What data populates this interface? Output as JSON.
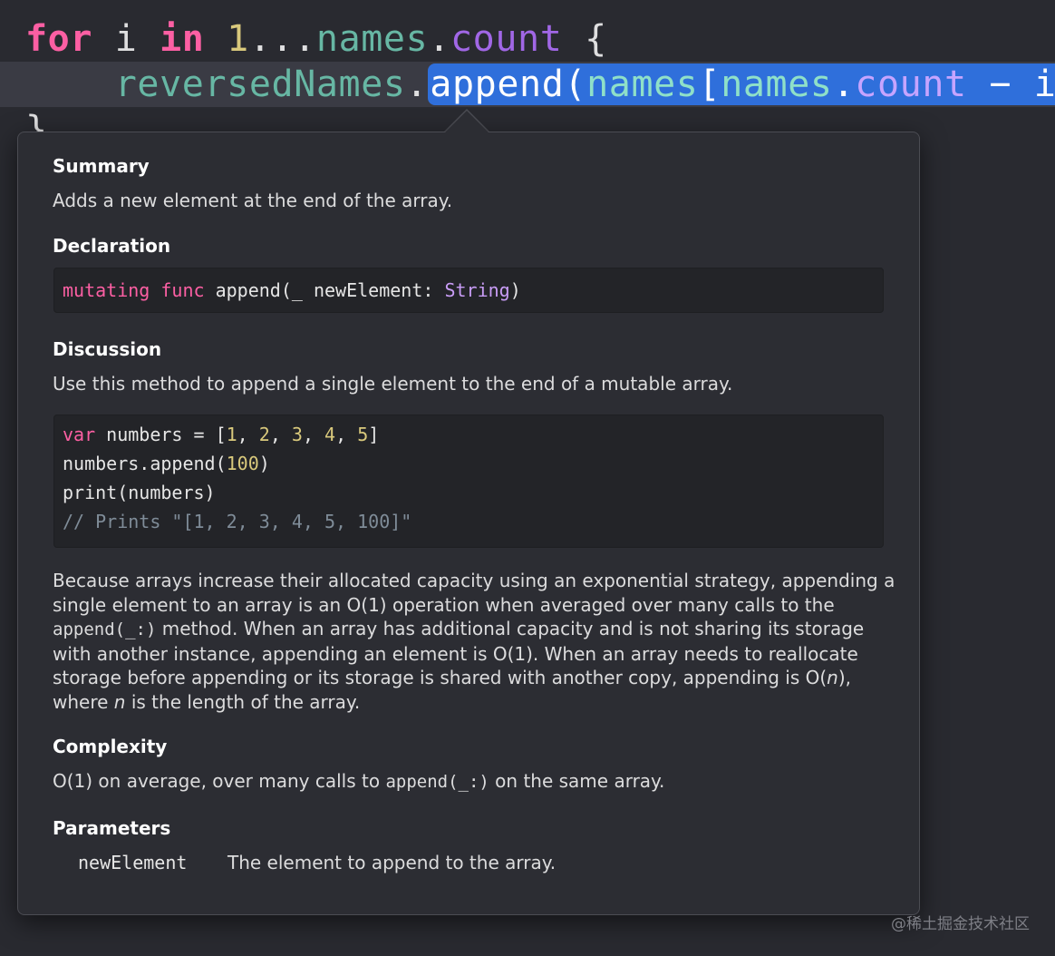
{
  "editor": {
    "line1": {
      "kw_for": "for",
      "var_i": " i ",
      "kw_in": "in",
      "num_1": " 1",
      "range_op": "...",
      "names": "names",
      "dot": ".",
      "count": "count",
      "brace": " {"
    },
    "line2": {
      "indent": "    ",
      "receiver": "reversedNames",
      "dot": ".",
      "append": "append",
      "paren_open": "(",
      "names1": "names",
      "bracket_open": "[",
      "names2": "names",
      "dot2": ".",
      "count": "count",
      "minus_i": " − i",
      "bracket_close": "]",
      "paren_close": ")"
    },
    "line3": {
      "brace": "}"
    }
  },
  "popover": {
    "summary": {
      "heading": "Summary",
      "text": "Adds a new element at the end of the array."
    },
    "declaration": {
      "heading": "Declaration",
      "kw_mutating": "mutating",
      "kw_func": "func",
      "signature": " append(_ newElement: ",
      "type": "String",
      "close": ")"
    },
    "discussion": {
      "heading": "Discussion",
      "text": "Use this method to append a single element to the end of a mutable array.",
      "example": {
        "l1_kw": "var",
        "l1_rest": " numbers = [",
        "l1_n1": "1",
        "l1_n2": "2",
        "l1_n3": "3",
        "l1_n4": "4",
        "l1_n5": "5",
        "sep": ", ",
        "l1_close": "]",
        "l2_pre": "numbers.append(",
        "l2_num": "100",
        "l2_post": ")",
        "l3": "print(numbers)",
        "l4": "// Prints \"[1, 2, 3, 4, 5, 100]\""
      },
      "p2_a": "Because arrays increase their allocated capacity using an exponential strategy, appending a single element to an array is an O(1) operation when averaged over many calls to the ",
      "p2_code": "append(_:)",
      "p2_b": " method. When an array has additional capacity and is not sharing its storage with another instance, appending an element is O(1). When an array needs to reallocate storage before appending or its storage is shared with another copy, appending is O(",
      "p2_n": "n",
      "p2_c": "), where ",
      "p2_n2": "n",
      "p2_d": " is the length of the array."
    },
    "complexity": {
      "heading": "Complexity",
      "text_a": "O(1) on average, over many calls to ",
      "code": "append(_:)",
      "text_b": " on the same array."
    },
    "parameters": {
      "heading": "Parameters",
      "name": "newElement",
      "desc": "The element to append to the array."
    }
  },
  "watermark": "@稀土掘金技术社区",
  "colors": {
    "keyword": "#fc5fa3",
    "number": "#d9c97c",
    "property": "#67b7a4",
    "method": "#a167e6",
    "selection": "#2f6fdb",
    "background": "#292a30",
    "popover": "#2c2d33"
  }
}
